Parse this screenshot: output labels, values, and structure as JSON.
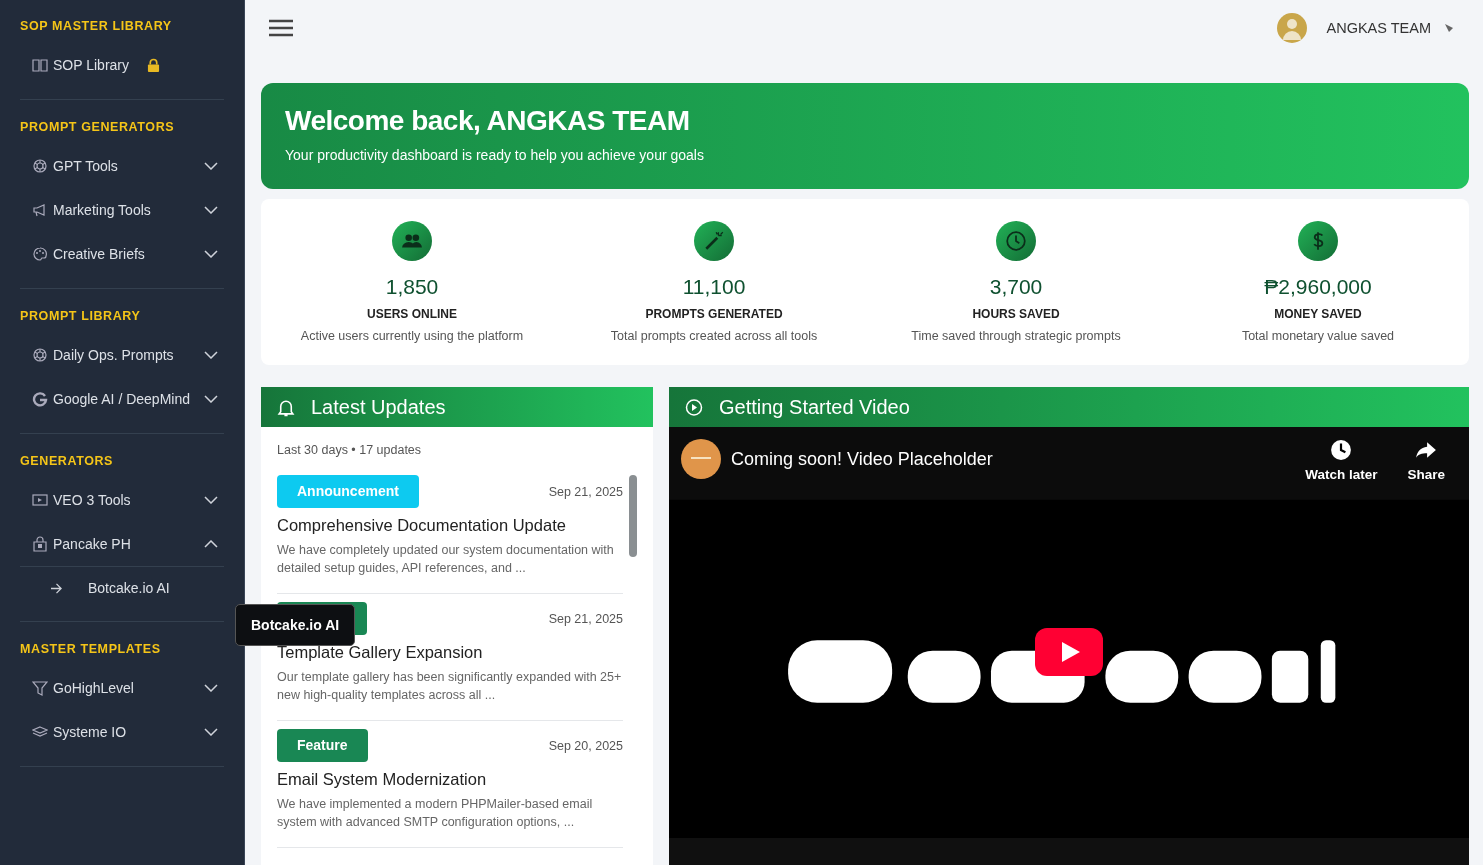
{
  "sidebar": {
    "sections": [
      {
        "title": "SOP MASTER LIBRARY",
        "items": [
          {
            "label": "SOP Library",
            "locked": true
          }
        ]
      },
      {
        "title": "PROMPT GENERATORS",
        "items": [
          {
            "label": "GPT Tools",
            "expanded": false
          },
          {
            "label": "Marketing Tools",
            "expanded": false
          },
          {
            "label": "Creative Briefs",
            "expanded": false
          }
        ]
      },
      {
        "title": "PROMPT LIBRARY",
        "items": [
          {
            "label": "Daily Ops. Prompts",
            "expanded": false
          },
          {
            "label": "Google AI / DeepMind",
            "expanded": false
          }
        ]
      },
      {
        "title": "GENERATORS",
        "items": [
          {
            "label": "VEO 3 Tools",
            "expanded": false
          },
          {
            "label": "Pancake PH",
            "expanded": true,
            "children": [
              {
                "label": "Botcake.io AI"
              }
            ]
          }
        ]
      },
      {
        "title": "MASTER TEMPLATES",
        "items": [
          {
            "label": "GoHighLevel",
            "expanded": false
          },
          {
            "label": "Systeme IO",
            "expanded": false
          }
        ]
      }
    ],
    "tooltip": "Botcake.io AI"
  },
  "header": {
    "user": "ANGKAS TEAM"
  },
  "banner": {
    "title": "Welcome back, ANGKAS TEAM",
    "subtitle": "Your productivity dashboard is ready to help you achieve your goals"
  },
  "stats": [
    {
      "value": "1,850",
      "label": "USERS ONLINE",
      "description": "Active users currently using the platform"
    },
    {
      "value": "11,100",
      "label": "PROMPTS GENERATED",
      "description": "Total prompts created across all tools"
    },
    {
      "value": "3,700",
      "label": "HOURS SAVED",
      "description": "Time saved through strategic prompts"
    },
    {
      "value": "₱2,960,000",
      "label": "MONEY SAVED",
      "description": "Total monetary value saved"
    }
  ],
  "updates": {
    "title": "Latest Updates",
    "summary": "Last 30 days • 17 updates",
    "items": [
      {
        "badge": "Announcement",
        "color": "#0dcaf0",
        "date": "Sep 21, 2025",
        "title": "Comprehensive Documentation Update",
        "text": "We have completely updated our system documentation with detailed setup guides, API references, and ..."
      },
      {
        "color": "#198754",
        "date": "Sep 21, 2025",
        "title": "Template Gallery Expansion",
        "text": "Our template gallery has been significantly expanded with 25+ new high-quality templates across all ..."
      },
      {
        "badge": "Feature",
        "color": "#198754",
        "date": "Sep 20, 2025",
        "title": "Email System Modernization",
        "text": "We have implemented a modern PHPMailer-based email system with advanced SMTP configuration options, ..."
      }
    ]
  },
  "video": {
    "title": "Getting Started Video",
    "player_title": "Coming soon! Video Placeholder",
    "actions": [
      "Watch later",
      "Share"
    ]
  }
}
